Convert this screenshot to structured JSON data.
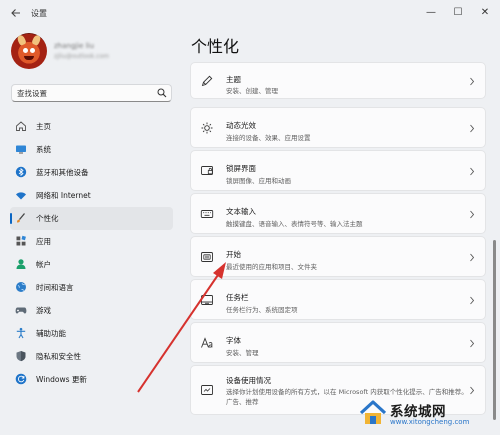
{
  "window": {
    "title": "设置",
    "back_icon": "back-arrow-icon",
    "controls": {
      "minimize": "—",
      "maximize": "☐",
      "close": "✕"
    }
  },
  "profile": {
    "name": "zhangjie liu",
    "email": "zjliu@outlook.com"
  },
  "search": {
    "value": "查找设置",
    "placeholder": "查找设置",
    "icon": "search-icon"
  },
  "sidebar": {
    "accent": "#0b66c3",
    "items": [
      {
        "label": "主页",
        "icon": "home-icon",
        "active": false
      },
      {
        "label": "系统",
        "icon": "monitor-icon",
        "active": false
      },
      {
        "label": "蓝牙和其他设备",
        "icon": "bluetooth-icon",
        "active": false
      },
      {
        "label": "网络和 Internet",
        "icon": "wifi-icon",
        "active": false
      },
      {
        "label": "个性化",
        "icon": "brush-icon",
        "active": true
      },
      {
        "label": "应用",
        "icon": "apps-icon",
        "active": false
      },
      {
        "label": "帐户",
        "icon": "person-icon",
        "active": false
      },
      {
        "label": "时间和语言",
        "icon": "globe-icon",
        "active": false
      },
      {
        "label": "游戏",
        "icon": "gamepad-icon",
        "active": false
      },
      {
        "label": "辅助功能",
        "icon": "accessibility-icon",
        "active": false
      },
      {
        "label": "隐私和安全性",
        "icon": "shield-icon",
        "active": false
      },
      {
        "label": "Windows 更新",
        "icon": "windows-update-icon",
        "active": false
      }
    ]
  },
  "main": {
    "title": "个性化",
    "cards": [
      {
        "title": "主题",
        "desc": "安装、创建、管理",
        "icon": "pen-icon"
      },
      {
        "title": "动态光效",
        "desc": "连接的设备、效果、应用设置",
        "icon": "sun-icon"
      },
      {
        "title": "锁屏界面",
        "desc": "锁屏图像、应用和动画",
        "icon": "lockscreen-icon"
      },
      {
        "title": "文本输入",
        "desc": "触摸键盘、语音输入、表情符号等、输入法主题",
        "icon": "keyboard-icon"
      },
      {
        "title": "开始",
        "desc": "最近使用的应用和项目、文件夹",
        "icon": "start-icon"
      },
      {
        "title": "任务栏",
        "desc": "任务栏行为、系统固定项",
        "icon": "taskbar-icon"
      },
      {
        "title": "字体",
        "desc": "安装、管理",
        "icon": "font-icon"
      },
      {
        "title": "设备使用情况",
        "desc": "选择你计划使用设备的所有方式，以在 Microsoft 内获取个性化提示、广告和推荐。",
        "desc2": "广告、推荐",
        "icon": "device-usage-icon"
      }
    ]
  },
  "watermark": {
    "text": "系统城网",
    "url": "www.xitongcheng.com",
    "icon": "house-logo-icon"
  },
  "colors": {
    "arrow": "#d6322e",
    "background": "#eef0f3",
    "card": "#fbfbfc"
  }
}
